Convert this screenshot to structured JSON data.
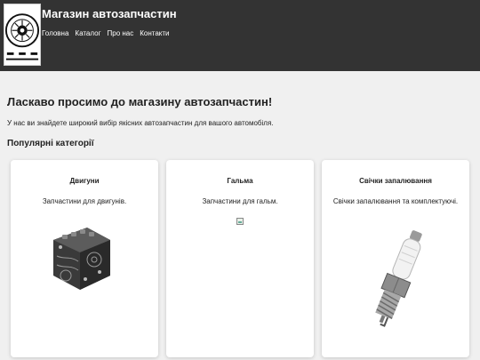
{
  "header": {
    "title": "Магазин автозапчастин",
    "logo_text": "AUTO PARTS ACCESSORIES",
    "nav": [
      "Головна",
      "Каталог",
      "Про нас",
      "Контакти"
    ],
    "background": "#333333"
  },
  "main": {
    "welcome": "Ласкаво просимо до магазину автозапчастин!",
    "intro": "У нас ви знайдете широкий вибір якісних автозапчастин для вашого автомобіля.",
    "popular_title": "Популярні категорії",
    "categories": [
      {
        "title": "Двигуни",
        "description": "Запчастини для двигунів.",
        "image": "engine-image"
      },
      {
        "title": "Гальма",
        "description": "Запчастини для гальм.",
        "image": "broken-image-icon"
      },
      {
        "title": "Свічки запалювання",
        "description": "Свічки запалювання та комплектуючі.",
        "image": "spark-plug-image"
      }
    ]
  }
}
